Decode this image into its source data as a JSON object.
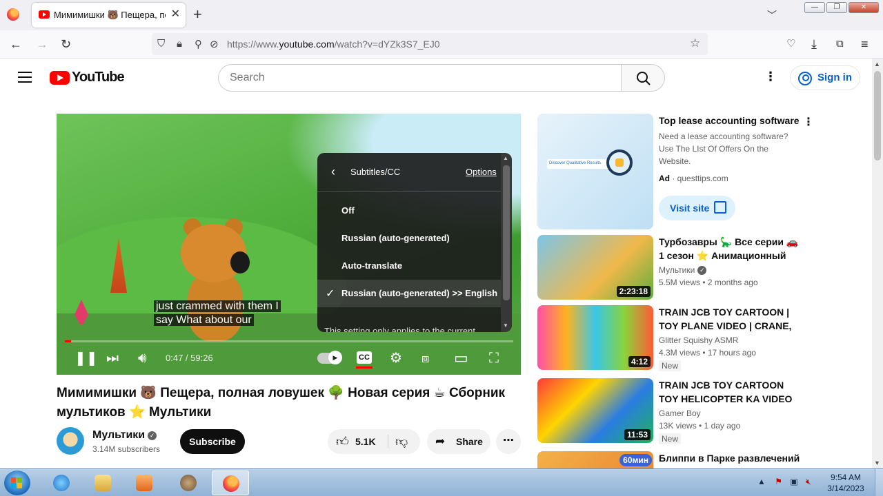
{
  "browser": {
    "tab_title": "Мимимишки 🐻 Пещера, полная ловушек",
    "tab_close": "✕",
    "new_tab": "+",
    "url_prefix": "https://www.",
    "url_domain": "youtube.com",
    "url_path": "/watch?v=dYZk3S7_EJ0"
  },
  "youtube": {
    "logo_text": "YouTube",
    "search_placeholder": "Search",
    "sign_in": "Sign in"
  },
  "player": {
    "caption_line1": "just crammed with them I",
    "caption_line2": "say What about our",
    "time": "0:47 / 59:26",
    "progress": 0.0132,
    "cc_label": "CC",
    "subtitles_menu": {
      "title": "Subtitles/CC",
      "options_link": "Options",
      "items": [
        {
          "label": "Off",
          "selected": false
        },
        {
          "label": "Russian (auto-generated)",
          "selected": false
        },
        {
          "label": "Auto-translate",
          "selected": false
        },
        {
          "label": "Russian (auto-generated) >> English",
          "selected": true
        }
      ],
      "note": "This setting only applies to the current"
    }
  },
  "video": {
    "title": "Мимимишки 🐻 Пещера, полная ловушек 🌳 Новая серия ☕ Сборник мультиков ⭐ Мультики",
    "channel": "Мультики",
    "subscribers": "3.14M subscribers",
    "subscribe": "Subscribe",
    "likes": "5.1K",
    "share": "Share"
  },
  "ad": {
    "title": "Top lease accounting software",
    "description": "Need a lease accounting software? Use The LIst Of Offers On the Website.",
    "label": "Ad",
    "domain": "questtips.com",
    "visit": "Visit site",
    "thumb_text": "Discover Qualitative Results"
  },
  "recommendations": [
    {
      "title": "Турбозавры 🦕 Все серии 🚗 1 сезон ⭐ Анимационный сериал для детей",
      "channel": "Мультики",
      "verified": true,
      "meta": "5.5M views • 2 months ago",
      "duration": "2:23:18",
      "badge": ""
    },
    {
      "title": "TRAIN JCB TOY CARTOON | TOY PLANE VIDEO | CRANE, TRUCK",
      "channel": "Glitter Squishy ASMR",
      "verified": false,
      "meta": "4.3M views • 17 hours ago",
      "duration": "4:12",
      "badge": "New"
    },
    {
      "title": "TRAIN JCB TOY CARTOON TOY HELICOPTER KA VIDEO CRANE",
      "channel": "Gamer Boy",
      "verified": false,
      "meta": "13K views • 1 day ago",
      "duration": "11:53",
      "badge": "New"
    },
    {
      "title": "Блиппи в Парке развлечений",
      "channel": "",
      "verified": false,
      "meta": "",
      "duration": "",
      "badge": "",
      "thumb_badge": "60мин"
    }
  ],
  "taskbar": {
    "time": "9:54 AM",
    "date": "3/14/2023"
  },
  "colors": {
    "youtube_red": "#ff0000",
    "link_blue": "#065fd4",
    "progress_red": "#ff0000"
  }
}
